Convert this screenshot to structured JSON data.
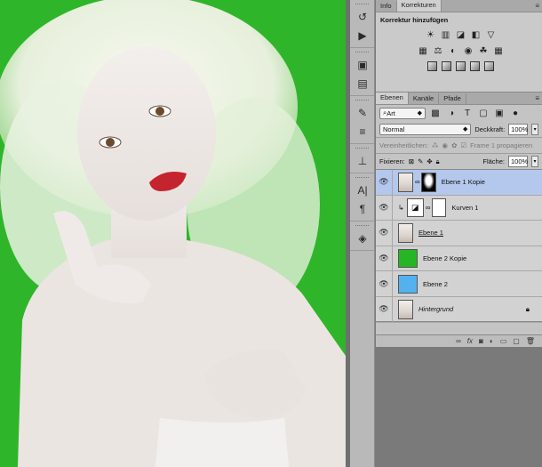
{
  "korrekturen_panel": {
    "tabs": [
      {
        "label": "Info",
        "active": false
      },
      {
        "label": "Korrekturen",
        "active": true
      }
    ],
    "title": "Korrektur hinzufügen",
    "icon_rows": [
      [
        "brightness-icon",
        "levels-icon",
        "curves-icon",
        "exposure-icon",
        "vibrance-icon"
      ],
      [
        "hue-saturation-icon",
        "color-balance-icon",
        "black-white-icon",
        "photo-filter-icon",
        "channel-mixer-icon",
        "color-lookup-icon"
      ],
      [
        "invert-icon",
        "posterize-icon",
        "threshold-icon",
        "gradient-map-icon",
        "selective-color-icon"
      ]
    ]
  },
  "ebenen_panel": {
    "tabs": [
      {
        "label": "Ebenen",
        "active": true
      },
      {
        "label": "Kanäle",
        "active": false
      },
      {
        "label": "Pfade",
        "active": false
      }
    ],
    "filter_kind": "Art",
    "blend_mode": "Normal",
    "opacity_label": "Deckkraft:",
    "opacity_value": "100%",
    "unify_label": "Vereinheitlichen:",
    "propagate_label": "Frame 1 propagieren",
    "lock_label": "Fixieren:",
    "fill_label": "Fläche:",
    "fill_value": "100%",
    "layers": [
      {
        "name": "Ebene 1 Kopie",
        "thumb": "face",
        "mask": "mask",
        "selected": true,
        "style": ""
      },
      {
        "name": "Kurven 1",
        "thumb": "curve",
        "mask": "whitemask",
        "selected": false,
        "style": "",
        "clipped": true
      },
      {
        "name": "Ebene 1",
        "thumb": "face",
        "selected": false,
        "style": "underline"
      },
      {
        "name": "Ebene 2 Kopie",
        "thumb": "green",
        "selected": false,
        "style": ""
      },
      {
        "name": "Ebene 2",
        "thumb": "blue",
        "selected": false,
        "style": ""
      },
      {
        "name": "Hintergrund",
        "thumb": "face",
        "selected": false,
        "style": "italic",
        "locked": true
      }
    ],
    "footer_icons": [
      "link-layers-icon",
      "fx-icon",
      "add-mask-icon",
      "new-adjustment-icon",
      "new-group-icon",
      "new-layer-icon",
      "delete-layer-icon"
    ]
  },
  "colors": {
    "canvas_green": "#2fb52a",
    "selection_blue": "#b3c8ec"
  }
}
